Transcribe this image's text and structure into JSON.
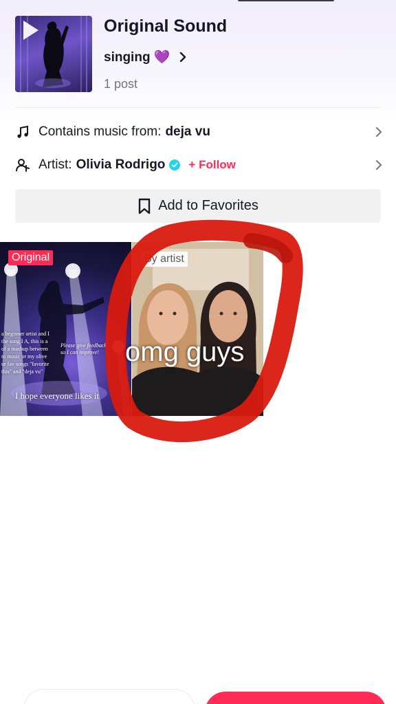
{
  "sound": {
    "title": "Original Sound",
    "author": "singing 💜",
    "post_count": "1 post"
  },
  "rows": {
    "music_label": "Contains music from:",
    "music_value": "deja vu",
    "artist_label": "Artist:",
    "artist_value": "Olivia Rodrigo",
    "follow_label": "+ Follow"
  },
  "favorites_button": "Add to Favorites",
  "videos": [
    {
      "badge": "Original",
      "text_lines": [
        "a beginner artist and I",
        "the song I A, this is a",
        "of a mashup between",
        "to music or my olive",
        "ur fav songs \"favorite",
        "this\" and \"deja vu\""
      ],
      "feedback_text": "Please give feedback so I can improve!",
      "bottom_text": "I hope everyone likes it"
    },
    {
      "badge": "By artist",
      "overlay_caption": "omg guys"
    }
  ],
  "colors": {
    "accent": "#fe2c55",
    "verified": "#20d5ec",
    "scribble": "#d91a0f"
  }
}
